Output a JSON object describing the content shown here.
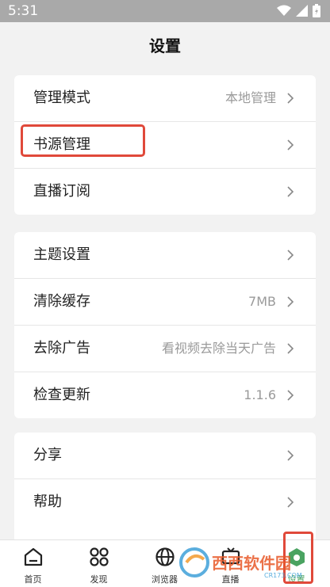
{
  "status_bar": {
    "time": "5:31"
  },
  "page": {
    "title": "设置"
  },
  "group1": {
    "items": [
      {
        "label": "管理模式",
        "value": "本地管理"
      },
      {
        "label": "书源管理",
        "value": ""
      },
      {
        "label": "直播订阅",
        "value": ""
      }
    ]
  },
  "group2": {
    "items": [
      {
        "label": "主题设置",
        "value": ""
      },
      {
        "label": "清除缓存",
        "value": "7MB"
      },
      {
        "label": "去除广告",
        "value": "看视频去除当天广告"
      },
      {
        "label": "检查更新",
        "value": "1.1.6"
      }
    ]
  },
  "group3": {
    "items": [
      {
        "label": "分享",
        "value": ""
      },
      {
        "label": "帮助",
        "value": ""
      }
    ]
  },
  "tabbar": {
    "tabs": [
      {
        "label": "首页",
        "icon": "home-icon"
      },
      {
        "label": "发现",
        "icon": "grid-icon"
      },
      {
        "label": "浏览器",
        "icon": "globe-icon"
      },
      {
        "label": "直播",
        "icon": "tv-icon"
      },
      {
        "label": "设置",
        "icon": "settings-icon",
        "active": true
      }
    ]
  },
  "watermark": {
    "text": "西西软件园",
    "sub": "CR173.COM"
  },
  "colors": {
    "accent": "#4aa361",
    "highlight": "#e0493a",
    "status_bar": "#a9a9a9"
  }
}
